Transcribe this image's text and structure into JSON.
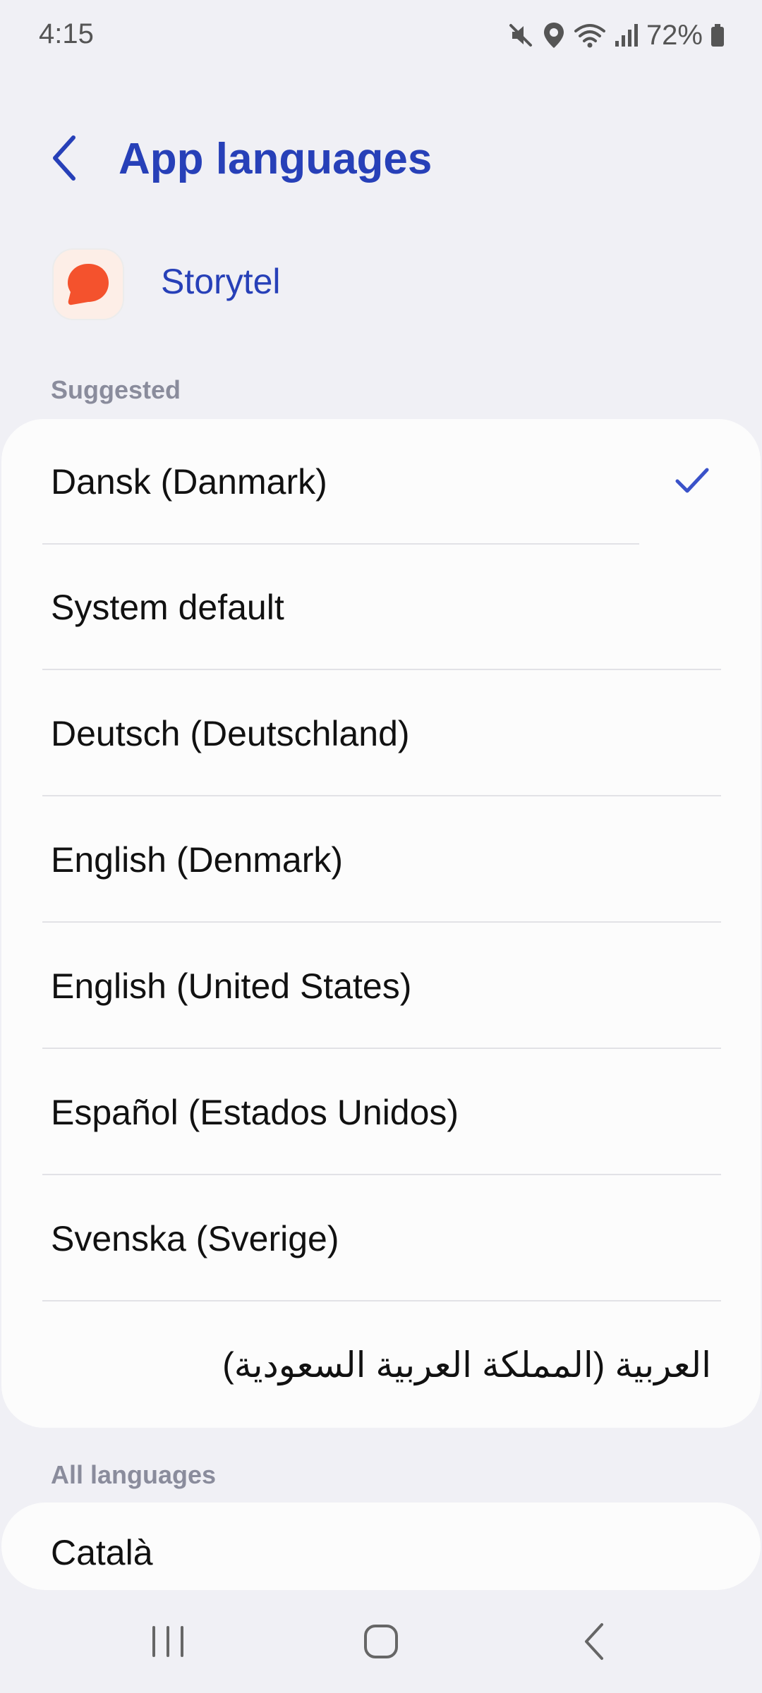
{
  "status_bar": {
    "time": "4:15",
    "battery": "72%",
    "icons": [
      "mute-icon",
      "location-icon",
      "wifi-icon",
      "signal-icon",
      "battery-icon"
    ]
  },
  "header": {
    "title": "App languages",
    "back_icon": "back-chevron-icon"
  },
  "app": {
    "name": "Storytel",
    "icon": "storytel-logo",
    "brand_color": "#f4522d"
  },
  "suggested": {
    "label": "Suggested",
    "items": [
      {
        "label": "Dansk (Danmark)",
        "selected": true
      },
      {
        "label": "System default",
        "selected": false
      },
      {
        "label": "Deutsch (Deutschland)",
        "selected": false
      },
      {
        "label": "English (Denmark)",
        "selected": false
      },
      {
        "label": "English (United States)",
        "selected": false
      },
      {
        "label": "Español (Estados Unidos)",
        "selected": false
      },
      {
        "label": "Svenska (Sverige)",
        "selected": false
      },
      {
        "label": "العربية (المملكة العربية السعودية)",
        "selected": false
      }
    ]
  },
  "all_languages": {
    "label": "All languages",
    "items": [
      {
        "label": "Català"
      }
    ]
  },
  "nav_bar": {
    "buttons": [
      "recents-icon",
      "home-icon",
      "back-icon"
    ]
  },
  "colors": {
    "accent": "#2740b8",
    "background": "#f0f0f5",
    "card": "#fcfcfc",
    "section_label": "#8a8c9c",
    "check": "#3a52c9"
  }
}
